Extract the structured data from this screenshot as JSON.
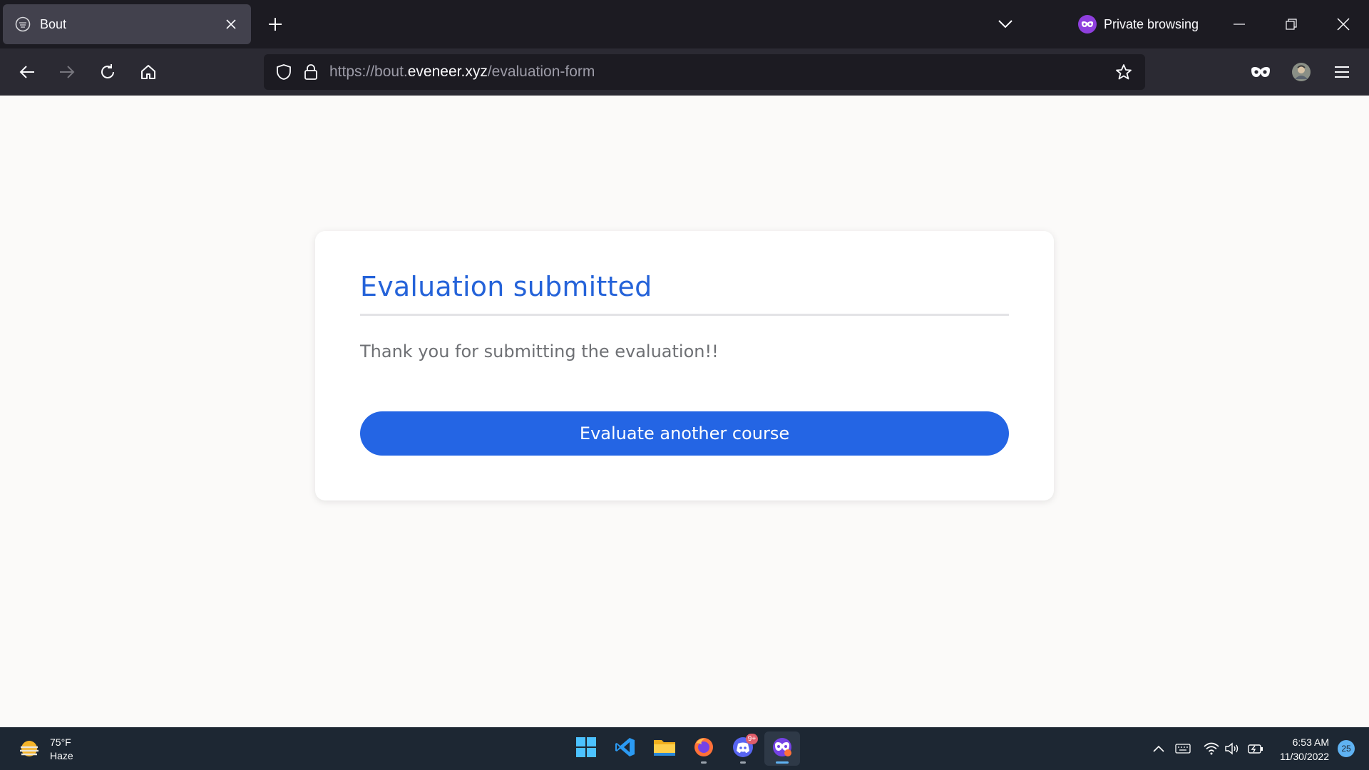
{
  "browser": {
    "tab": {
      "title": "Bout"
    },
    "private_label": "Private browsing",
    "url": {
      "prefix": "https://bout.",
      "host": "eveneer.xyz",
      "path": "/evaluation-form"
    }
  },
  "page": {
    "title": "Evaluation submitted",
    "message": "Thank you for submitting the evaluation!!",
    "button_label": "Evaluate another course"
  },
  "taskbar": {
    "weather": {
      "temp": "75°F",
      "condition": "Haze"
    },
    "apps": [
      {
        "name": "start",
        "icon": "windows-logo-icon"
      },
      {
        "name": "vscode",
        "icon": "vscode-icon"
      },
      {
        "name": "file-explorer",
        "icon": "folder-icon"
      },
      {
        "name": "firefox",
        "icon": "firefox-icon"
      },
      {
        "name": "discord",
        "icon": "discord-icon",
        "badge": "9+"
      },
      {
        "name": "firefox-private",
        "icon": "private-browsing-icon"
      }
    ],
    "clock": {
      "time": "6:53 AM",
      "date": "11/30/2022"
    },
    "notifications": "25"
  },
  "colors": {
    "accent": "#2465e4",
    "title": "#2563d9",
    "private": "#8f3fde"
  }
}
